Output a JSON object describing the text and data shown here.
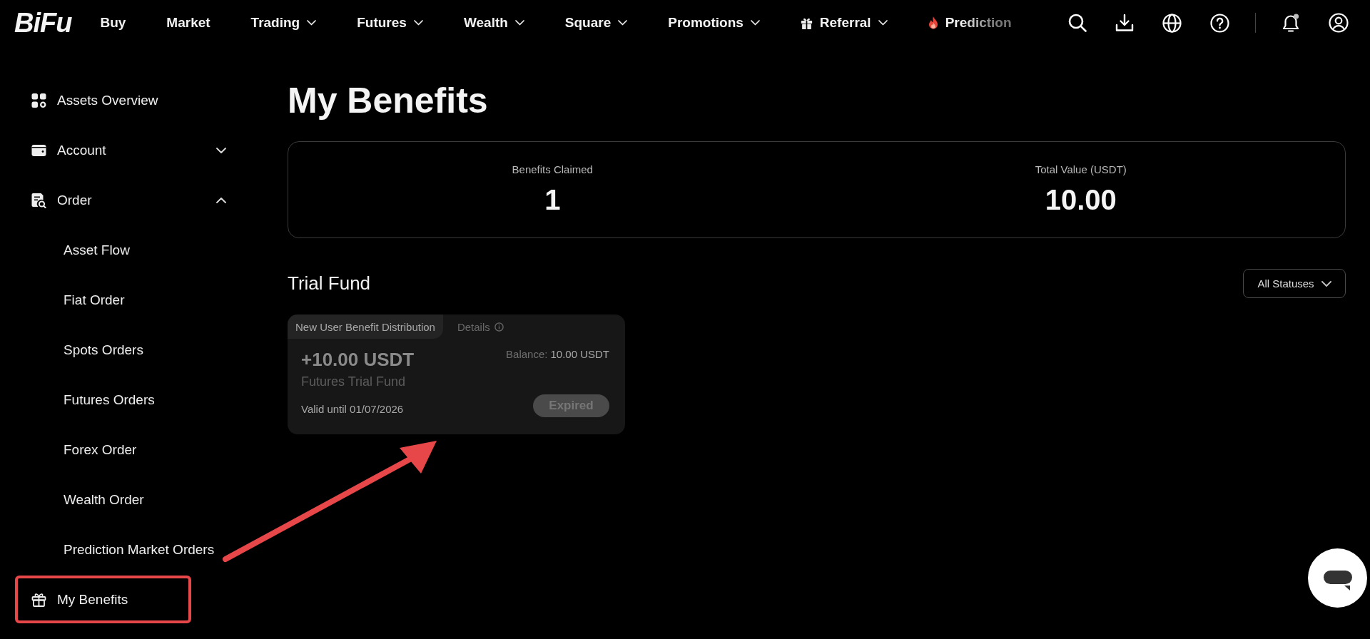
{
  "header": {
    "logo": "BiFu",
    "nav": [
      {
        "label": "Buy",
        "kind": "link"
      },
      {
        "label": "Market",
        "kind": "link"
      },
      {
        "label": "Trading",
        "kind": "menu"
      },
      {
        "label": "Futures",
        "kind": "menu"
      },
      {
        "label": "Wealth",
        "kind": "menu"
      },
      {
        "label": "Square",
        "kind": "menu"
      },
      {
        "label": "Promotions",
        "kind": "menu"
      },
      {
        "label": "Referral",
        "kind": "menu"
      },
      {
        "label": "Prediction",
        "kind": "link"
      }
    ],
    "notifications_unread": true
  },
  "sidebar": {
    "items": [
      {
        "label": "Assets Overview",
        "kind": "link",
        "highlighted": false
      },
      {
        "label": "Account",
        "kind": "group",
        "expanded": false,
        "highlighted": false
      },
      {
        "label": "Order",
        "kind": "group",
        "expanded": true,
        "highlighted": false,
        "children": [
          {
            "label": "Asset Flow"
          },
          {
            "label": "Fiat Order"
          },
          {
            "label": "Spots Orders"
          },
          {
            "label": "Futures Orders"
          },
          {
            "label": "Forex Order"
          },
          {
            "label": "Wealth Order"
          },
          {
            "label": "Prediction Market Orders"
          }
        ]
      },
      {
        "label": "My Benefits",
        "kind": "link",
        "highlighted": true
      }
    ]
  },
  "page": {
    "title": "My Benefits",
    "stats": [
      {
        "label": "Benefits Claimed",
        "value": "1"
      },
      {
        "label": "Total Value (USDT)",
        "value": "10.00"
      }
    ],
    "section": {
      "title": "Trial Fund",
      "filter": {
        "value": "All Statuses"
      },
      "cards": [
        {
          "tab": "New User Benefit Distribution",
          "details": "Details",
          "amount": "+10.00 USDT",
          "name": "Futures Trial Fund",
          "validity": "Valid until 01/07/2026",
          "balance_label": "Balance:",
          "balance_value": "10.00 USDT",
          "status": "Expired",
          "expired": true
        }
      ]
    }
  }
}
